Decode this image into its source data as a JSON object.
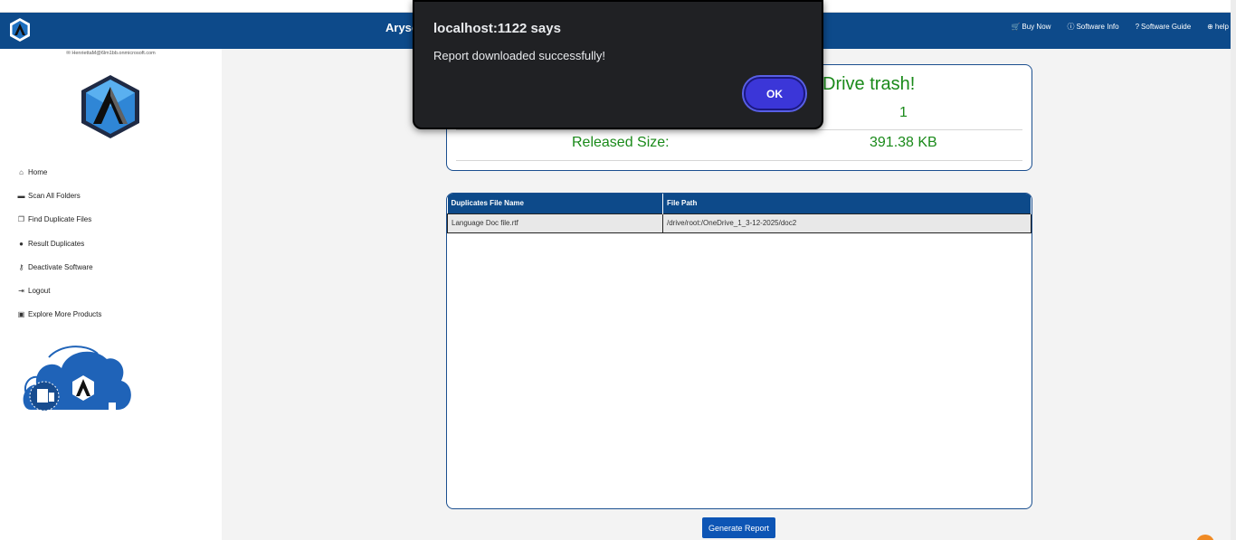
{
  "alert": {
    "title": "localhost:1122 says",
    "message": "Report downloaded successfully!",
    "ok_label": "OK"
  },
  "header": {
    "app_title_visible": "Aryso",
    "nav": [
      {
        "label": "Buy Now",
        "icon": "cart-icon"
      },
      {
        "label": "Software Info",
        "icon": "info-icon"
      },
      {
        "label": "Software Guide",
        "icon": "question-icon"
      },
      {
        "label": "help",
        "icon": "lifebuoy-icon"
      }
    ]
  },
  "sidebar": {
    "email": "HenriettaM@6lm1bb.onmicrosoft.com",
    "menu": [
      {
        "label": "Home",
        "icon": "home-icon"
      },
      {
        "label": "Scan All Folders",
        "icon": "folder-icon"
      },
      {
        "label": "Find Duplicate Files",
        "icon": "copy-icon"
      },
      {
        "label": "Result Duplicates",
        "icon": "user-icon"
      },
      {
        "label": "Deactivate Software",
        "icon": "key-icon"
      },
      {
        "label": "Logout",
        "icon": "logout-icon"
      },
      {
        "label": "Explore More Products",
        "icon": "briefcase-icon"
      }
    ]
  },
  "summary": {
    "heading_visible": "Drive trash!",
    "count_value": "1",
    "released_label": "Released Size:",
    "released_value": "391.38 KB"
  },
  "table": {
    "headers": [
      "Duplicates File Name",
      "File Path"
    ],
    "rows": [
      [
        "Language Doc file.rtf",
        "/drive/root:/OneDrive_1_3-12-2025/doc2"
      ]
    ]
  },
  "actions": {
    "generate_report_label": "Generate Report"
  },
  "colors": {
    "brand_blue": "#0d4a8a",
    "success_green": "#1a8a1a",
    "dialog_bg": "#202124",
    "ok_button": "#3b36d8"
  }
}
